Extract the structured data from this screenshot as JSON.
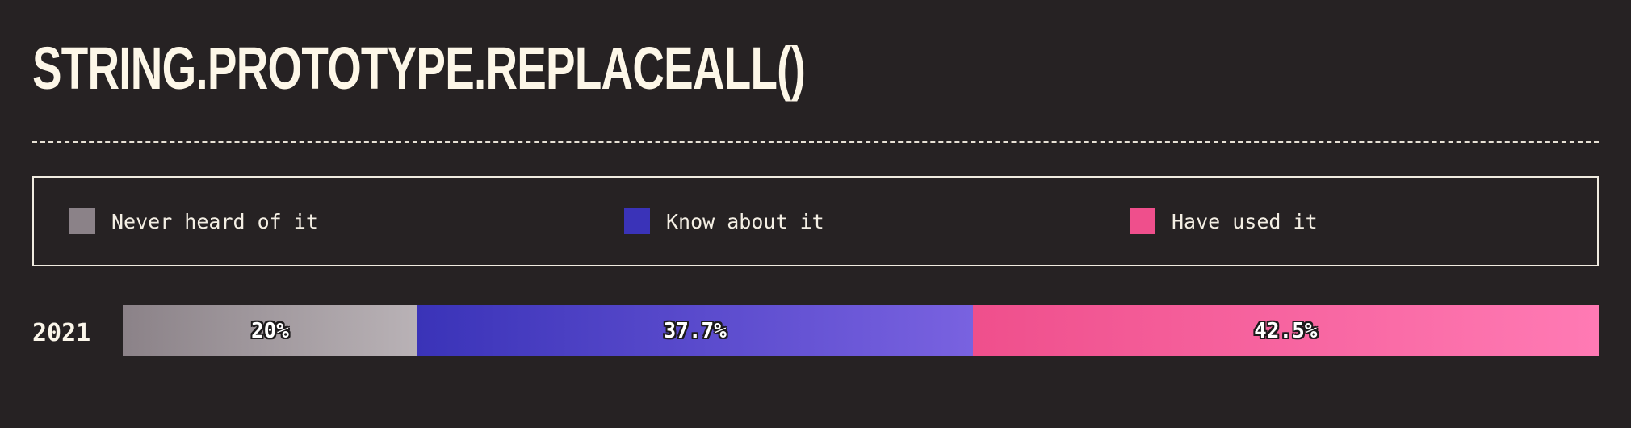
{
  "title": "STRING.PROTOTYPE.REPLACEALL()",
  "chart_data": {
    "type": "bar",
    "orientation": "horizontal-stacked",
    "categories": [
      "2021"
    ],
    "series": [
      {
        "name": "Never heard of it",
        "values": [
          20
        ],
        "label": "20%",
        "color_start": "#8b8288",
        "color_end": "#b9b2b6"
      },
      {
        "name": "Know about it",
        "values": [
          37.7
        ],
        "label": "37.7%",
        "color_start": "#3a33b8",
        "color_end": "#7962e0"
      },
      {
        "name": "Have used it",
        "values": [
          42.5
        ],
        "label": "42.5%",
        "color_start": "#ef4f8c",
        "color_end": "#ff7ab4"
      }
    ],
    "unit": "%",
    "legend_position": "top",
    "grid": false
  },
  "legend": [
    {
      "label": "Never heard of it",
      "color": "#8b8288"
    },
    {
      "label": "Know about it",
      "color": "#3a33b8"
    },
    {
      "label": "Have used it",
      "color": "#ef4f8c"
    }
  ],
  "colors": {
    "background": "#262223",
    "text": "#fbf6ea"
  }
}
